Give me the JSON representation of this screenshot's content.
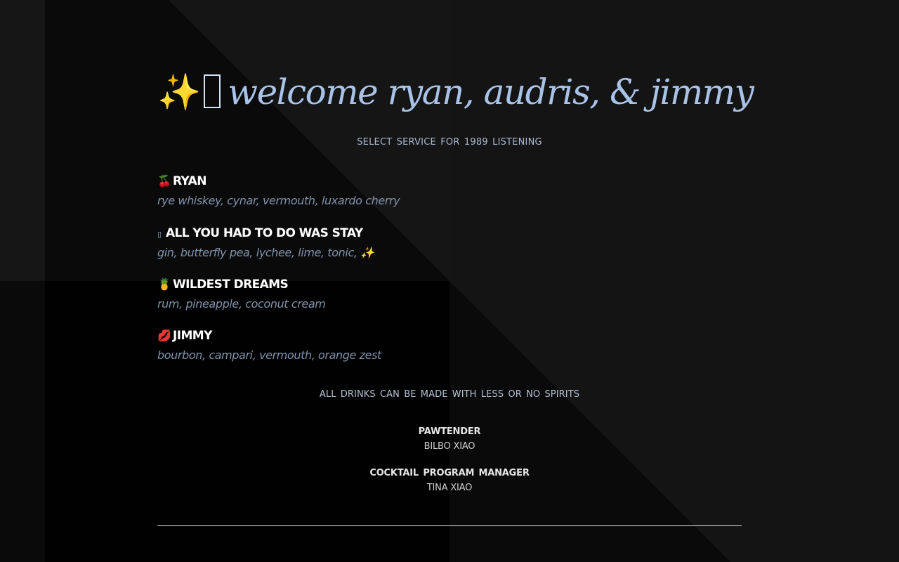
{
  "header": {
    "sparkle": "✨",
    "title": "welcome ryan, audris, & jimmy",
    "subtitle": "SELECT SERVICE FOR 1989 LISTENING"
  },
  "drinks": [
    {
      "icon": "🍒",
      "name": "RYAN",
      "description": "rye whiskey, cynar, vermouth, luxardo cherry"
    },
    {
      "icon": "▯",
      "name": "ALL YOU HAD TO DO WAS STAY",
      "description": "gin, butterfly pea, lychee, lime, tonic, ✨"
    },
    {
      "icon": "🍍",
      "name": "WILDEST DREAMS",
      "description": "rum, pineapple, coconut cream"
    },
    {
      "icon": "💋",
      "name": "JIMMY",
      "description": "bourbon, campari, vermouth, orange zest"
    }
  ],
  "note": "ALL DRINKS CAN BE MADE WITH LESS OR NO SPIRITS",
  "credits": [
    {
      "role": "PAWTENDER",
      "name": "BILBO XIAO"
    },
    {
      "role": "COCKTAIL PROGRAM MANAGER",
      "name": "TINA XIAO"
    }
  ],
  "colors": {
    "accent": "#a9c3e8",
    "description": "#7f92ad",
    "background_dark": "#030303",
    "background_light": "#151515"
  }
}
